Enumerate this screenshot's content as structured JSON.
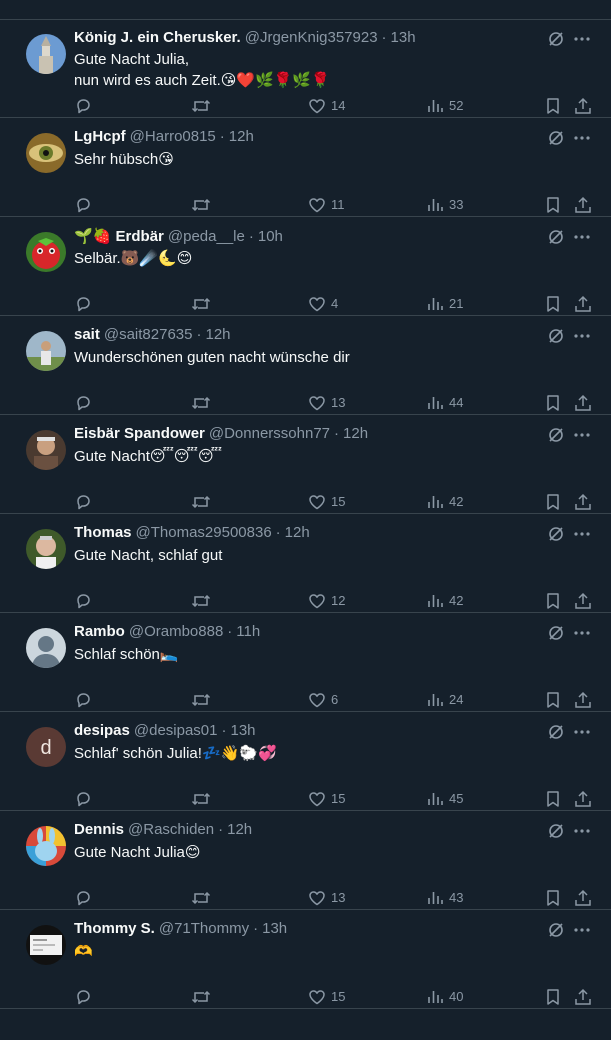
{
  "tweets": [
    {
      "name": "König J. ein Cherusker.",
      "handle": "@JrgenKnig357923",
      "time": "13h",
      "text": "Gute Nacht Julia,\nnun wird es auch Zeit.",
      "emojis": "😘❤️🌿🌹🌿🌹",
      "likes": "14",
      "views": "52",
      "avatar": "tower"
    },
    {
      "name": "LgHcpf",
      "handle": "@Harro0815",
      "time": "12h",
      "text": "Sehr hübsch",
      "emojis": "😘",
      "likes": "11",
      "views": "33",
      "avatar": "eye"
    },
    {
      "name": "Erdbär",
      "name_prefix_emojis": "🌱🍓",
      "handle": "@peda__le",
      "time": "10h",
      "text": "Selbär.",
      "emojis": "🐻☄️🌜😊",
      "likes": "4",
      "views": "21",
      "avatar": "strawberry"
    },
    {
      "name": "sait",
      "handle": "@sait827635",
      "time": "12h",
      "text": "Wunderschönen guten nacht wünsche dir",
      "emojis": "",
      "likes": "13",
      "views": "44",
      "avatar": "outdoor"
    },
    {
      "name": "Eisbär Spandower",
      "handle": "@Donnerssohn77",
      "time": "12h",
      "text": "Gute Nacht",
      "emojis": "😴😴😴",
      "likes": "15",
      "views": "42",
      "avatar": "man-brown"
    },
    {
      "name": "Thomas",
      "handle": "@Thomas29500836",
      "time": "12h",
      "text": "Gute Nacht, schlaf gut",
      "emojis": "",
      "likes": "12",
      "views": "42",
      "avatar": "man-green"
    },
    {
      "name": "Rambo",
      "handle": "@Orambo888",
      "time": "11h",
      "text": "Schlaf schön",
      "emojis": "🛌",
      "likes": "6",
      "views": "24",
      "avatar": "default"
    },
    {
      "name": "desipas",
      "handle": "@desipas01",
      "time": "13h",
      "text": "Schlaf' schön Julia!",
      "emojis": "💤👋🐑💞",
      "likes": "15",
      "views": "45",
      "avatar": "letter-d",
      "avatar_letter": "d"
    },
    {
      "name": "Dennis",
      "handle": "@Raschiden",
      "time": "12h",
      "text": "Gute Nacht Julia",
      "emojis": "😊",
      "likes": "13",
      "views": "43",
      "avatar": "bunny"
    },
    {
      "name": "Thommy S.",
      "handle": "@71Thommy",
      "time": "13h",
      "text": "",
      "emojis": "🫶",
      "likes": "15",
      "views": "40",
      "avatar": "card"
    }
  ],
  "colors": {
    "background": "#15202b",
    "divider": "#38444d",
    "muted": "#8b98a5",
    "text": "#f7f9f9"
  },
  "icons": [
    "grok-icon",
    "more-icon",
    "reply-icon",
    "retweet-icon",
    "like-icon",
    "views-icon",
    "bookmark-icon",
    "share-icon"
  ]
}
